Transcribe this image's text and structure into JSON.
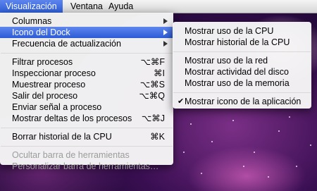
{
  "menubar": {
    "items": [
      {
        "label": "Visualización",
        "active": true
      },
      {
        "label": "Ventana",
        "active": false
      },
      {
        "label": "Ayuda",
        "active": false
      }
    ]
  },
  "view_menu": {
    "columns": "Columnas",
    "dock_icon": "Icono del Dock",
    "refresh_rate": "Frecuencia de actualización",
    "filter_processes": {
      "label": "Filtrar procesos",
      "shortcut": "⌥⌘F"
    },
    "inspect_process": {
      "label": "Inspeccionar proceso",
      "shortcut": "⌘I"
    },
    "sample_process": {
      "label": "Muestrear proceso",
      "shortcut": "⌥⌘S"
    },
    "quit_process": {
      "label": "Salir del proceso",
      "shortcut": "⌥⌘Q"
    },
    "send_signal": {
      "label": "Enviar señal a proceso"
    },
    "show_deltas": {
      "label": "Mostrar deltas de los procesos",
      "shortcut": "⌥⌘J"
    },
    "clear_cpu_history": {
      "label": "Borrar historial de la CPU",
      "shortcut": "⌘K"
    },
    "hide_toolbar": "Ocultar barra de herramientas",
    "customize_toolbar": "Personalizar barra de herramientas…"
  },
  "dock_submenu": {
    "cpu_usage": "Mostrar uso de la CPU",
    "cpu_history": "Mostrar historial de la CPU",
    "network_usage": "Mostrar uso de la red",
    "disk_activity": "Mostrar actividad del disco",
    "memory_usage": "Mostrar uso de la memoria",
    "app_icon": "Mostrar icono de la aplicación",
    "checked_item": "app_icon"
  },
  "colors": {
    "highlight": "#3a68e0",
    "menu_background": "#f6f6f6",
    "disabled_text": "#9c9c9c"
  }
}
